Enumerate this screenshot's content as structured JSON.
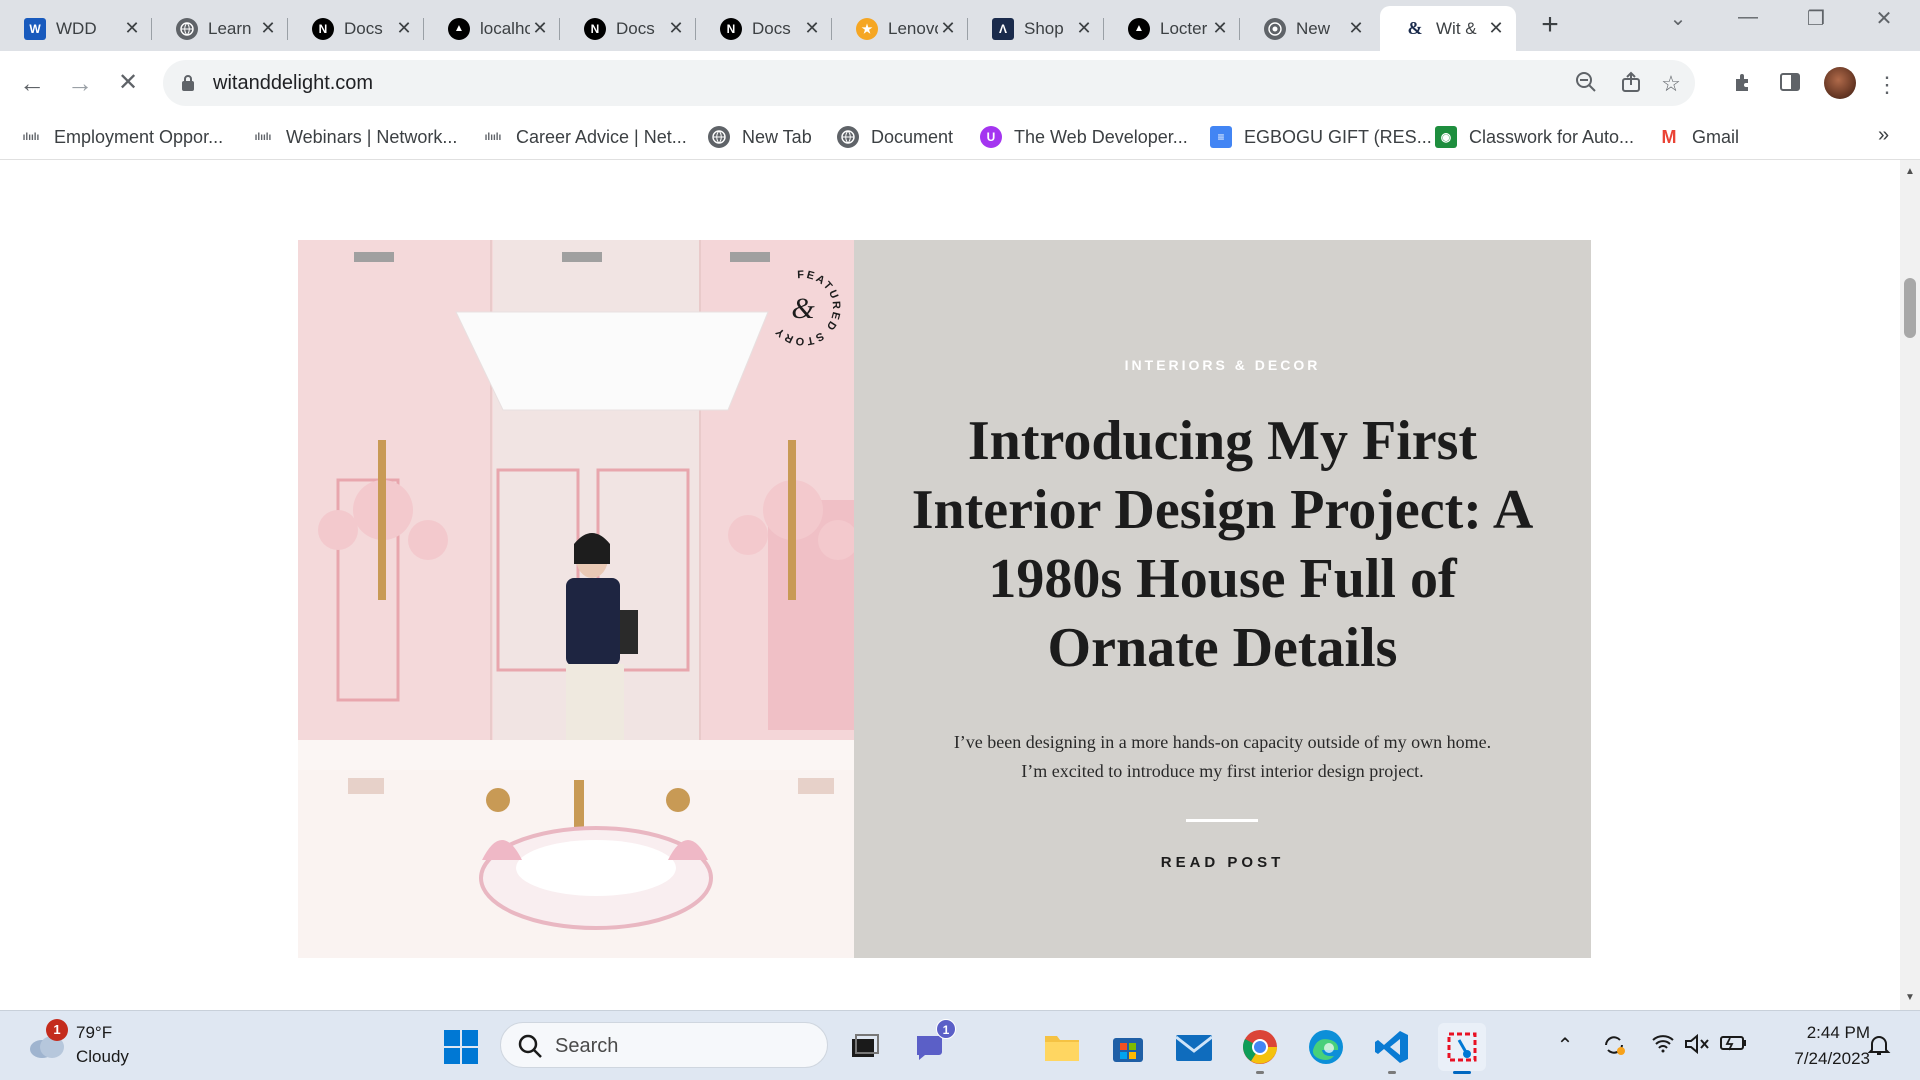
{
  "tabs": [
    {
      "title": "WDD",
      "icon": "word-icon",
      "color": "#185abd",
      "glyph": "W"
    },
    {
      "title": "Learn",
      "icon": "globe-icon",
      "color": "#5f6368",
      "glyph": ""
    },
    {
      "title": "Docs",
      "icon": "next-logo-icon",
      "color": "#000000",
      "glyph": "N"
    },
    {
      "title": "localhost",
      "icon": "vercel-triangle-icon",
      "color": "#000000",
      "glyph": "▲"
    },
    {
      "title": "Docs",
      "icon": "next-logo-icon",
      "color": "#000000",
      "glyph": "N"
    },
    {
      "title": "Docs",
      "icon": "next-logo-icon",
      "color": "#000000",
      "glyph": "N"
    },
    {
      "title": "Lenovo",
      "icon": "star-badge-icon",
      "color": "#f5a623",
      "glyph": "★"
    },
    {
      "title": "Shop",
      "icon": "lambda-icon",
      "color": "#1a2b4c",
      "glyph": "Λ"
    },
    {
      "title": "Locter",
      "icon": "vercel-triangle-icon",
      "color": "#000000",
      "glyph": "▲"
    },
    {
      "title": "New",
      "icon": "chrome-icon",
      "color": "#5f6368",
      "glyph": ""
    },
    {
      "title": "Wit &",
      "icon": "wit-delight-icon",
      "color": "#ffffff",
      "glyph": "&"
    }
  ],
  "browser": {
    "url": "witanddelight.com"
  },
  "bookmarks": [
    {
      "label": "Employment Oppor...",
      "icon": "cisco-icon"
    },
    {
      "label": "Webinars | Network...",
      "icon": "cisco-icon"
    },
    {
      "label": "Career Advice | Net...",
      "icon": "cisco-icon"
    },
    {
      "label": "New Tab",
      "icon": "globe-icon"
    },
    {
      "label": "Document",
      "icon": "globe-icon"
    },
    {
      "label": "The Web Developer...",
      "icon": "udemy-icon"
    },
    {
      "label": "EGBOGU GIFT (RES...",
      "icon": "google-docs-icon"
    },
    {
      "label": "Classwork for Auto...",
      "icon": "classroom-icon"
    },
    {
      "label": "Gmail",
      "icon": "gmail-icon"
    }
  ],
  "feature": {
    "badge_text": "FEATURED STORY",
    "category": "INTERIORS & DECOR",
    "headline": "Introducing My First Interior Design Project: A 1980s House Full of Ornate Details",
    "excerpt": "I’ve been designing in a more hands-on capacity outside of my own home. I’m excited to introduce my first interior design project.",
    "cta": "READ POST",
    "panel_color": "#d3d1cd"
  },
  "taskbar": {
    "weather_temp": "79°F",
    "weather_desc": "Cloudy",
    "weather_badge": "1",
    "search_placeholder": "Search",
    "chat_badge": "1",
    "time": "2:44 PM",
    "date": "7/24/2023"
  }
}
